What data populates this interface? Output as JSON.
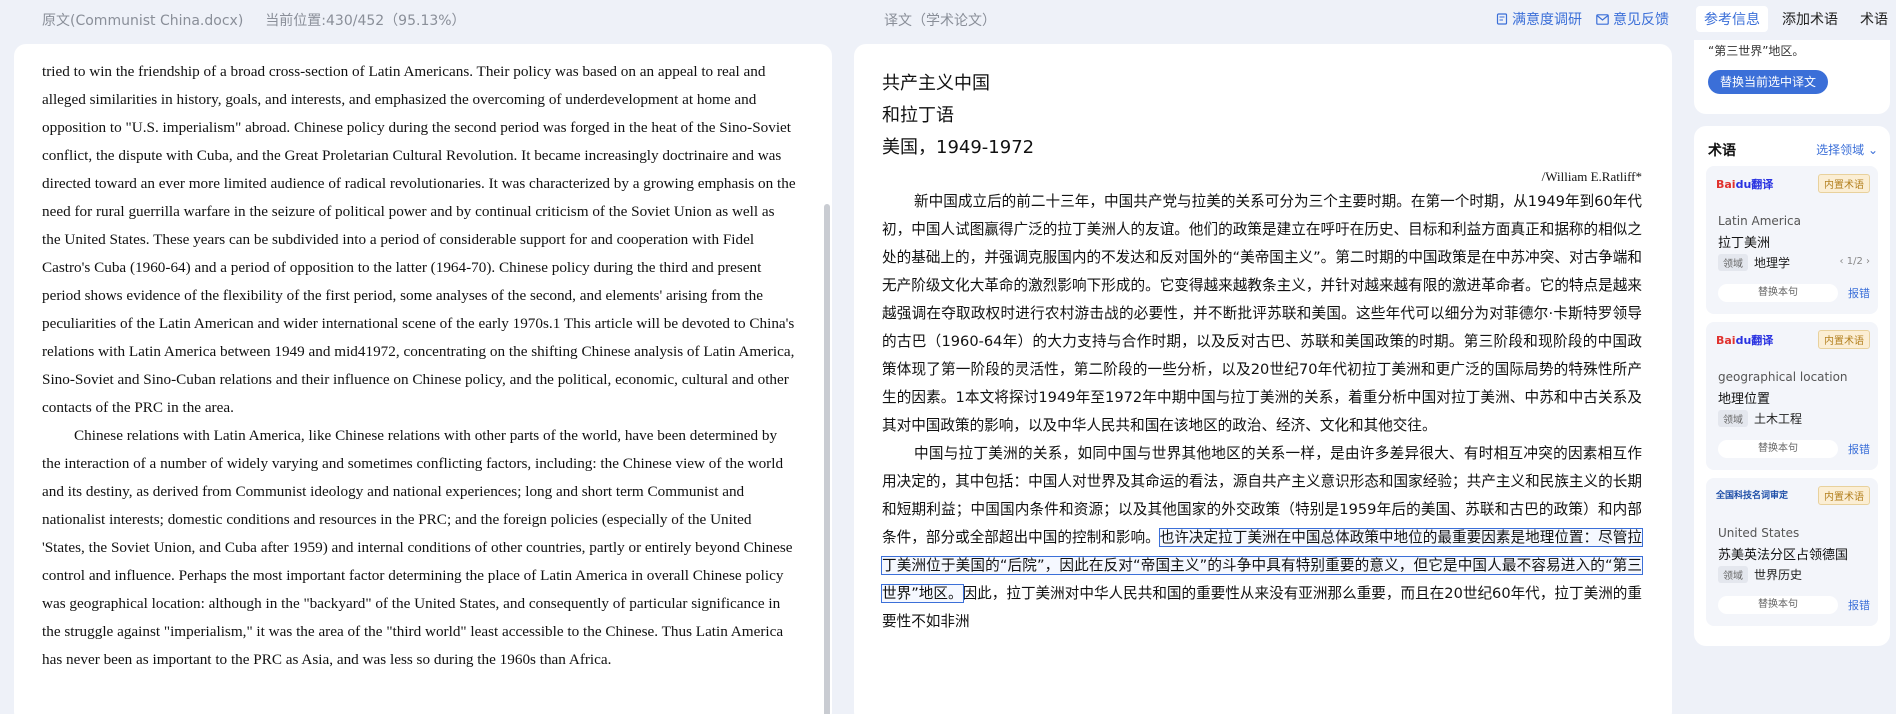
{
  "header": {
    "source_title": "原文(Communist China.docx)",
    "position": "当前位置:430/452（95.13%）",
    "target_title": "译文（学术论文）",
    "survey_label": "满意度调研",
    "feedback_label": "意见反馈",
    "tabs": [
      {
        "label": "参考信息"
      },
      {
        "label": "添加术语"
      },
      {
        "label": "术语"
      }
    ]
  },
  "source": {
    "paragraphs": [
      "tried to win the friendship of a broad cross-section of Latin Americans. Their policy was based on an appeal to real and alleged similarities in history, goals, and interests, and emphasized the overcoming of underdevelopment at home and opposition to \"U.S. imperialism\" abroad. Chinese policy during the second period was forged in the heat of the Sino-Soviet conflict, the dispute with Cuba, and the Great Proletarian Cultural Revolution. It became increasingly doctrinaire and was directed toward an ever more limited audience of radical revolutionaries. It was characterized by a growing emphasis on the need for rural guerrilla warfare in the seizure of political power and by continual criticism of the Soviet Union as well as the United States. These years can be subdivided into a period of considerable support for and cooperation with Fidel Castro's Cuba (1960-64) and a period of opposition to the latter (1964-70). Chinese policy during the third and present period shows evidence of the flexibility of the first period, some analyses of the second, and elements' arising from the peculiarities of the Latin American and wider international scene of the early 1970s.1 This article will be devoted to China's relations with Latin America between 1949 and mid41972, concentrating on the shifting Chinese analysis of Latin America, Sino-Soviet and Sino-Cuban relations and their influence on Chinese policy, and the political, economic, cultural and other contacts of the PRC in the area.",
      "Chinese relations with Latin America, like Chinese relations with other parts of the world, have been determined by the interaction of a number of widely varying and sometimes conflicting factors, including: the Chinese view of the world and its destiny, as derived from Communist ideology and national experiences; long and short term Communist and nationalist interests; domestic conditions and resources in the PRC; and the foreign policies (especially of the United 'States, the Soviet Union, and Cuba after 1959) and internal conditions of other countries, partly or entirely beyond Chinese control and influence. Perhaps the most important factor determining the place of Latin America in overall Chinese policy was geographical location: although in the \"backyard\" of the United States, and consequently of particular significance in the struggle against \"imperialism,\" it was the area of the \"third world\" least accessible to the Chinese. Thus Latin America has never been as important to the PRC as Asia, and was less so during the 1960s than Africa."
    ]
  },
  "target": {
    "title_lines": [
      "共产主义中国",
      "和拉丁语",
      "美国，1949-1972"
    ],
    "author": "/William E.Ratliff*",
    "para1": "新中国成立后的前二十三年，中国共产党与拉美的关系可分为三个主要时期。在第一个时期，从1949年到60年代初，中国人试图赢得广泛的拉丁美洲人的友谊。他们的政策是建立在呼吁在历史、目标和利益方面真正和据称的相似之处的基础上的，并强调克服国内的不发达和反对国外的“美帝国主义”。第二时期的中国政策是在中苏冲突、对古争端和无产阶级文化大革命的激烈影响下形成的。它变得越来越教条主义，并针对越来越有限的激进革命者。它的特点是越来越强调在夺取政权时进行农村游击战的必要性，并不断批评苏联和美国。这些年代可以细分为对菲德尔·卡斯特罗领导的古巴（1960-64年）的大力支持与合作时期，以及反对古巴、苏联和美国政策的时期。第三阶段和现阶段的中国政策体现了第一阶段的灵活性，第二阶段的一些分析，以及20世纪70年代初拉丁美洲和更广泛的国际局势的特殊性所产生的因素。1本文将探讨1949年至1972年中期中国与拉丁美洲的关系，着重分析中国对拉丁美洲、中苏和中古关系及其对中国政策的影响，以及中华人民共和国在该地区的政治、经济、文化和其他交往。",
    "para2_a": "中国与拉丁美洲的关系，如同中国与世界其他地区的关系一样，是由许多差异很大、有时相互冲突的因素相互作用决定的，其中包括：中国人对世界及其命运的看法，源自共产主义意识形态和国家经验；共产主义和民族主义的长期和短期利益；中国国内条件和资源；以及其他国家的外交政策（特别是1959年后的美国、苏联和古巴的政策）和内部条件，部分或全部超出中国的控制和影响。",
    "para2_highlight": "也许决定拉丁美洲在中国总体政策中地位的最重要因素是地理位置：尽管拉丁美洲位于美国的“后院”，因此在反对“帝国主义”的斗争中具有特别重要的意义，但它是中国人最不容易进入的“第三世界”地区。",
    "para2_b": "因此，拉丁美洲对中华人民共和国的重要性从来没有亚洲那么重要，而且在20世纪60年代，拉丁美洲的重要性不如非洲"
  },
  "reference": {
    "tail_text": "“第三世界”地区。",
    "replace_button": "替换当前选中译文"
  },
  "terms": {
    "heading": "术语",
    "domain_select": "选择领域",
    "badge": "内置术语",
    "domain_tag": "领域",
    "replace_label": "替换本句",
    "report_label": "报错",
    "cards": [
      {
        "source_name": "Baidu翻译",
        "en": "Latin America",
        "zh": "拉丁美洲",
        "domain": "地理学",
        "pager": "1/2"
      },
      {
        "source_name": "Baidu翻译",
        "en": "geographical location",
        "zh": "地理位置",
        "domain": "土木工程",
        "pager": ""
      },
      {
        "source_name": "全国科技名词审定",
        "en": "United States",
        "zh": "苏美英法分区占领德国",
        "domain": "世界历史",
        "pager": ""
      }
    ]
  },
  "colors": {
    "accent": "#3b6fd8",
    "badge_bg": "#fbeed4",
    "badge_text": "#b3801f"
  }
}
